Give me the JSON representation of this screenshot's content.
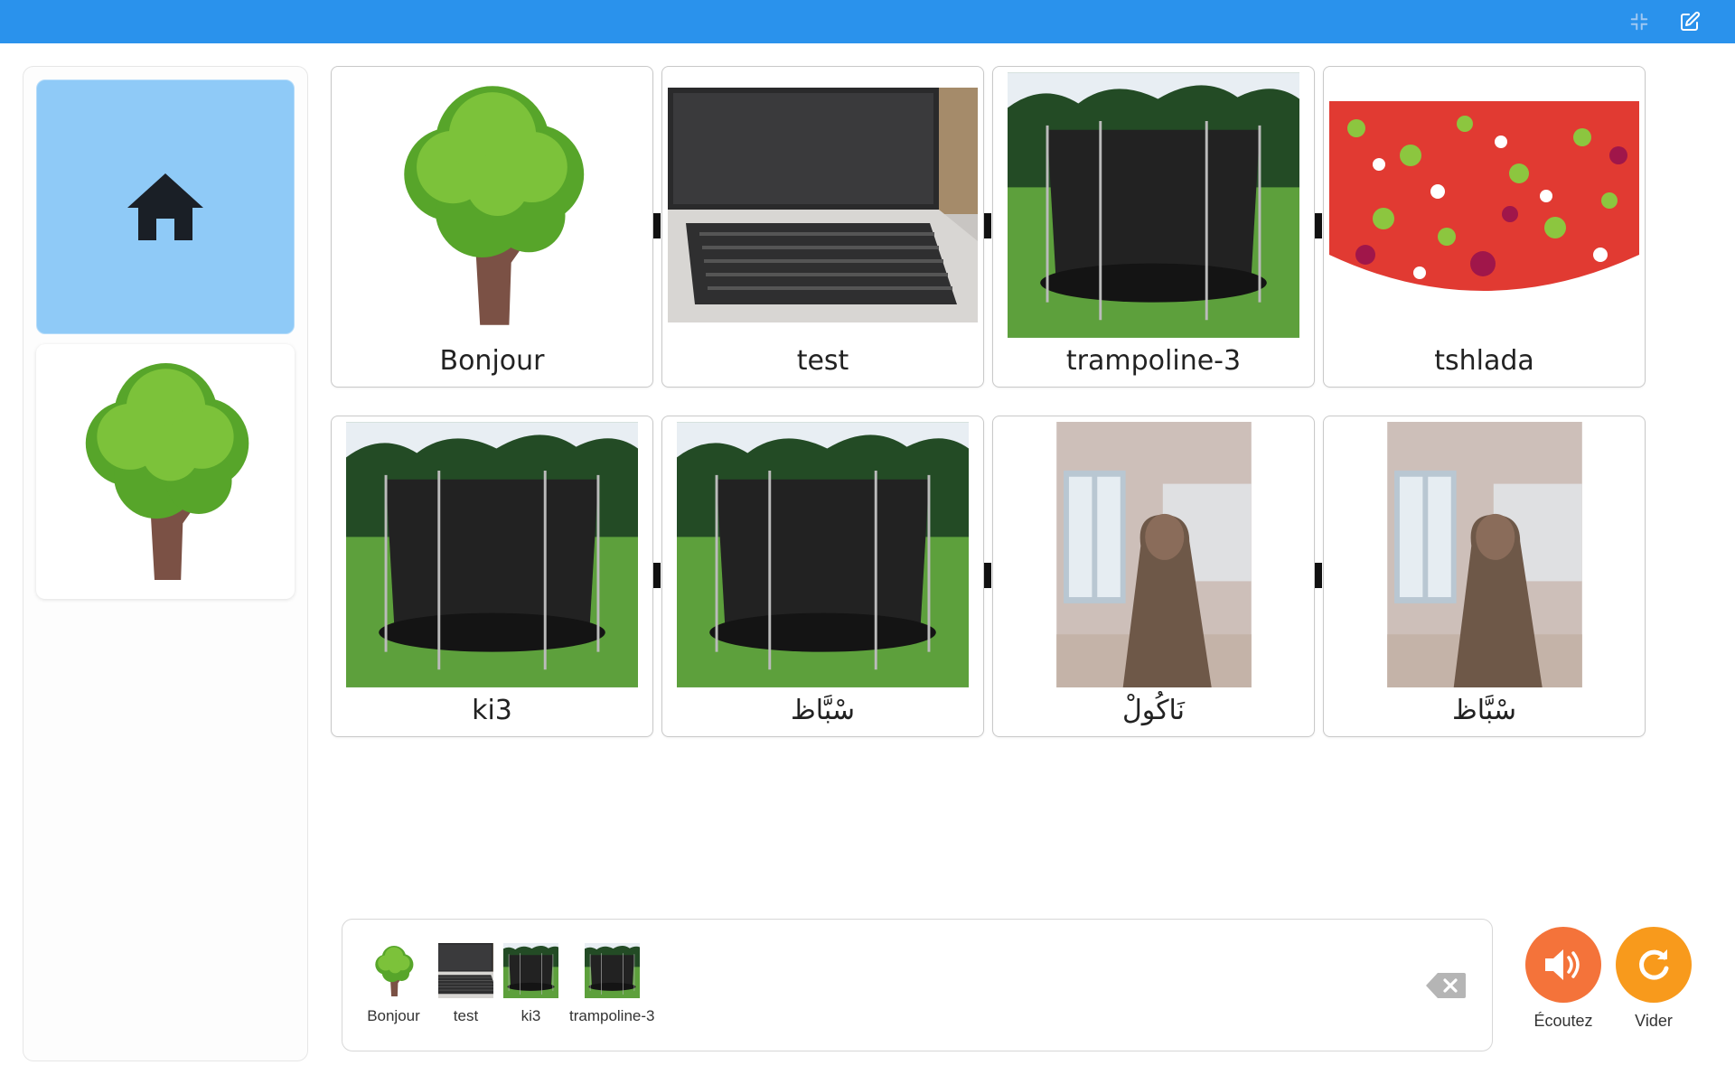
{
  "colors": {
    "topbar": "#2a92ec",
    "home_tile": "#8fcaf7",
    "listen_button": "#f4733a",
    "clear_button": "#f89a1c"
  },
  "topbar": {
    "icons": [
      "collapse-icon",
      "edit-icon"
    ]
  },
  "sidebar": {
    "items": [
      {
        "icon": "home-icon"
      },
      {
        "icon": "tree-icon"
      }
    ]
  },
  "grid": {
    "cards": [
      {
        "label": "Bonjour",
        "image": "tree"
      },
      {
        "label": "test",
        "image": "laptop"
      },
      {
        "label": "trampoline-3",
        "image": "trampoline"
      },
      {
        "label": "tshlada",
        "image": "salad"
      },
      {
        "label": "ki3",
        "image": "trampoline"
      },
      {
        "label": "سْبَّاظ",
        "image": "trampoline"
      },
      {
        "label": "نَاكُولْ",
        "image": "person"
      },
      {
        "label": "سْبَّاظ",
        "image": "person"
      }
    ]
  },
  "sentence": {
    "chips": [
      {
        "label": "Bonjour",
        "image": "tree"
      },
      {
        "label": "test",
        "image": "laptop"
      },
      {
        "label": "ki3",
        "image": "trampoline"
      },
      {
        "label": "trampoline-3",
        "image": "trampoline"
      }
    ]
  },
  "actions": {
    "listen_label": "Écoutez",
    "clear_label": "Vider"
  }
}
